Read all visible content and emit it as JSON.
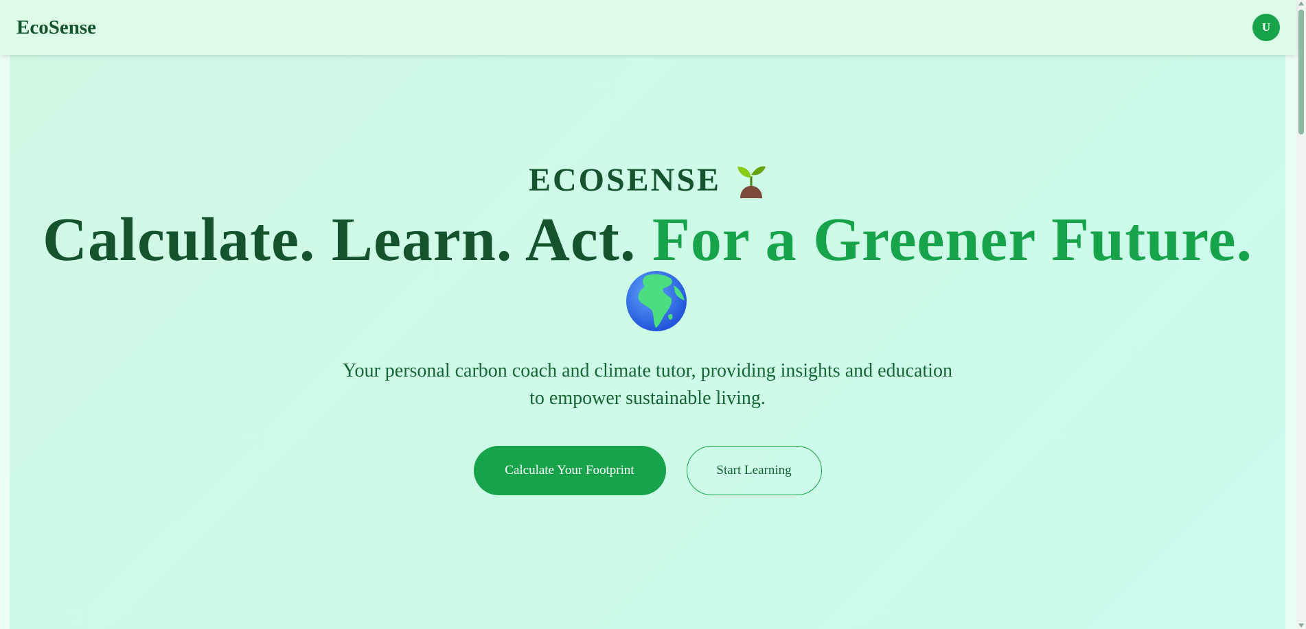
{
  "navbar": {
    "brand": "EcoSense",
    "avatar_initial": "U"
  },
  "hero": {
    "eyebrow": "ECOSENSE",
    "eyebrow_icon": "seedling-icon",
    "headline_dark": "Calculate. Learn. Act.",
    "headline_accent": "For a Greener Future.",
    "headline_icon": "globe-africa-icon",
    "subtitle_line1": "Your personal carbon coach and climate tutor, providing insights and education",
    "subtitle_line2": "to empower sustainable living.",
    "primary_button": "Calculate Your Footprint",
    "secondary_button": "Start Learning"
  },
  "colors": {
    "brand_dark": "#14532d",
    "accent_green": "#16a34a",
    "hero_bg": "#d1fae5",
    "navbar_bg": "#dcfce7"
  }
}
